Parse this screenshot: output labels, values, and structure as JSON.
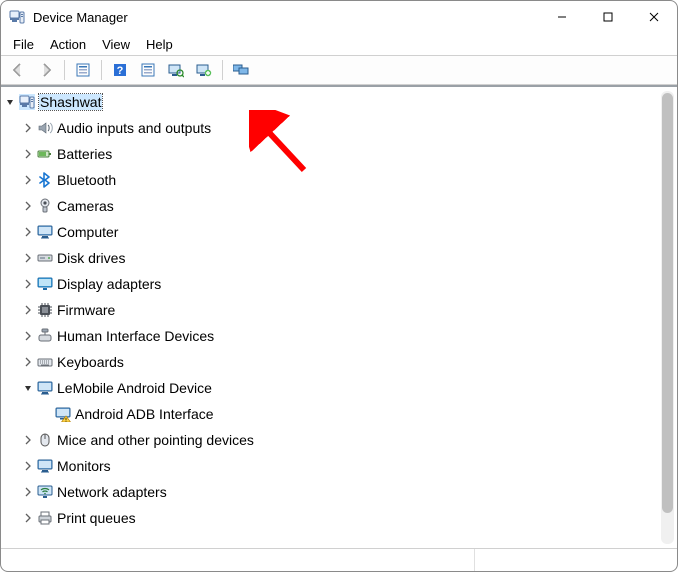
{
  "window": {
    "title": "Device Manager"
  },
  "menubar": {
    "file": "File",
    "action": "Action",
    "view": "View",
    "help": "Help"
  },
  "tree": {
    "root": {
      "label": "Shashwat",
      "expanded": true,
      "selected": true
    },
    "children": [
      {
        "label": "Audio inputs and outputs",
        "icon": "speaker",
        "expanded": false
      },
      {
        "label": "Batteries",
        "icon": "battery",
        "expanded": false
      },
      {
        "label": "Bluetooth",
        "icon": "bluetooth",
        "expanded": false
      },
      {
        "label": "Cameras",
        "icon": "camera",
        "expanded": false
      },
      {
        "label": "Computer",
        "icon": "monitor",
        "expanded": false
      },
      {
        "label": "Disk drives",
        "icon": "disk",
        "expanded": false
      },
      {
        "label": "Display adapters",
        "icon": "display",
        "expanded": false
      },
      {
        "label": "Firmware",
        "icon": "chip",
        "expanded": false
      },
      {
        "label": "Human Interface Devices",
        "icon": "hid",
        "expanded": false
      },
      {
        "label": "Keyboards",
        "icon": "keyboard",
        "expanded": false
      },
      {
        "label": "LeMobile Android Device",
        "icon": "monitor",
        "expanded": true,
        "children": [
          {
            "label": "Android ADB Interface",
            "icon": "monitor-warn"
          }
        ]
      },
      {
        "label": "Mice and other pointing devices",
        "icon": "mouse",
        "expanded": false
      },
      {
        "label": "Monitors",
        "icon": "monitor",
        "expanded": false
      },
      {
        "label": "Network adapters",
        "icon": "network",
        "expanded": false
      },
      {
        "label": "Print queues",
        "icon": "printer",
        "expanded": false
      }
    ]
  },
  "annotation": {
    "kind": "arrow",
    "color": "#ff0000",
    "target": "Audio inputs and outputs"
  }
}
